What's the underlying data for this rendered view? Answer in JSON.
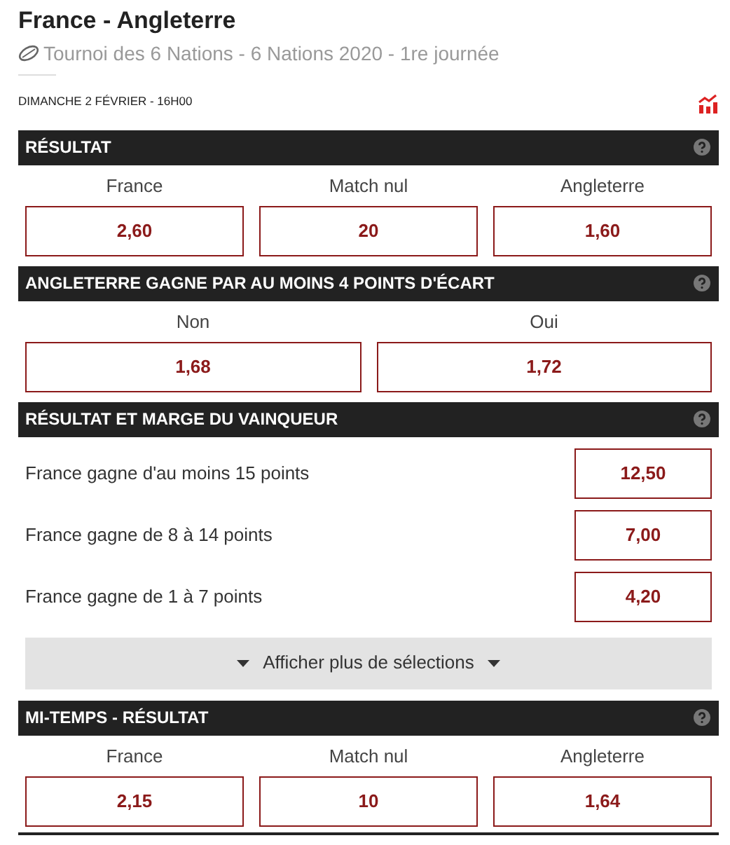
{
  "title": "France - Angleterre",
  "competition": "Tournoi des 6 Nations - 6 Nations 2020 - 1re journée",
  "date": "DIMANCHE 2 FÉVRIER - 16H00",
  "markets": [
    {
      "kind": "grid",
      "title": "RÉSULTAT",
      "outcomes": [
        {
          "label": "France",
          "odds": "2,60"
        },
        {
          "label": "Match nul",
          "odds": "20"
        },
        {
          "label": "Angleterre",
          "odds": "1,60"
        }
      ]
    },
    {
      "kind": "grid",
      "title": "ANGLETERRE GAGNE PAR AU MOINS 4 POINTS D'ÉCART",
      "outcomes": [
        {
          "label": "Non",
          "odds": "1,68"
        },
        {
          "label": "Oui",
          "odds": "1,72"
        }
      ]
    },
    {
      "kind": "list",
      "title": "RÉSULTAT ET MARGE DU VAINQUEUR",
      "outcomes": [
        {
          "label": "France gagne d'au moins 15 points",
          "odds": "12,50"
        },
        {
          "label": "France gagne de 8 à 14 points",
          "odds": "7,00"
        },
        {
          "label": "France gagne de 1 à 7 points",
          "odds": "4,20"
        }
      ],
      "more_button": "Afficher plus de sélections"
    },
    {
      "kind": "grid",
      "title": "MI-TEMPS - RÉSULTAT",
      "outcomes": [
        {
          "label": "France",
          "odds": "2,15"
        },
        {
          "label": "Match nul",
          "odds": "10"
        },
        {
          "label": "Angleterre",
          "odds": "1,64"
        }
      ]
    }
  ]
}
